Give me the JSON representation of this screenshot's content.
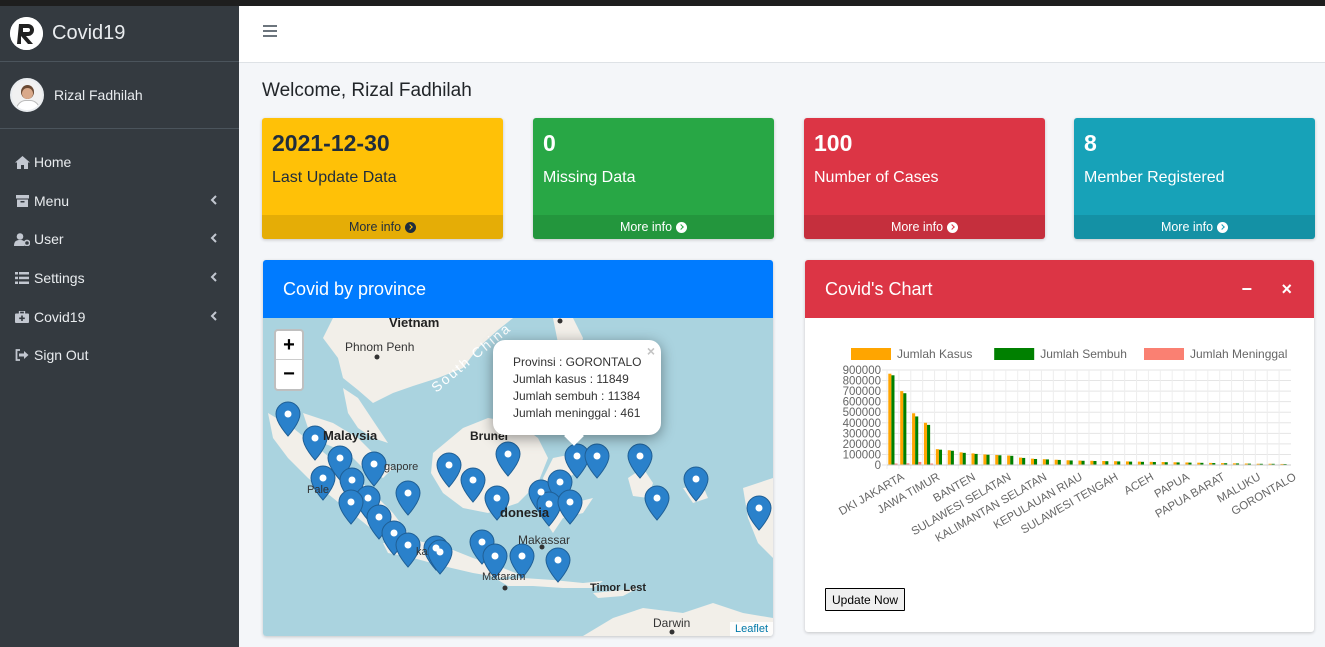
{
  "app": {
    "title": "Covid19"
  },
  "user": {
    "name": "Rizal Fadhilah"
  },
  "sidebar": {
    "items": [
      {
        "label": "Home",
        "icon": "home-icon",
        "arrow": false
      },
      {
        "label": "Menu",
        "icon": "archive-icon",
        "arrow": true
      },
      {
        "label": "User",
        "icon": "user-gear-icon",
        "arrow": true
      },
      {
        "label": "Settings",
        "icon": "list-icon",
        "arrow": true
      },
      {
        "label": "Covid19",
        "icon": "briefcase-medical-icon",
        "arrow": true
      },
      {
        "label": "Sign Out",
        "icon": "sign-out-icon",
        "arrow": false
      }
    ]
  },
  "welcome": "Welcome, Rizal Fadhilah",
  "boxes": [
    {
      "value": "2021-12-30",
      "label": "Last Update Data",
      "footer": "More info",
      "color": "#ffc107"
    },
    {
      "value": "0",
      "label": "Missing Data",
      "footer": "More info",
      "color": "#28a745"
    },
    {
      "value": "100",
      "label": "Number of Cases",
      "footer": "More info",
      "color": "#dc3545"
    },
    {
      "value": "8",
      "label": "Member Registered",
      "footer": "More info",
      "color": "#17a2b8"
    }
  ],
  "map_card": {
    "title": "Covid by province",
    "zoom_in": "+",
    "zoom_out": "−",
    "attribution": "Leaflet",
    "popup": {
      "close": "×",
      "province": "Provinsi : GORONTALO",
      "cases": "Jumlah kasus : 11849",
      "recovered": "Jumlah sembuh : 11384",
      "deaths": "Jumlah meninggal : 461"
    },
    "labels": {
      "vietnam": "Vietnam",
      "phnom_penh": "Phnom Penh",
      "malaysia": "Malaysia",
      "brunei": "Brunei",
      "singapore": "gapore",
      "indonesia": "donesia",
      "makassar": "Makassar",
      "mataram": "Mataram",
      "timor": "Timor Lest",
      "darwin": "Darwin",
      "south_china": "South China",
      "palembang": "Pale",
      "jakarta": "ka"
    }
  },
  "chart_card": {
    "title": "Covid's Chart",
    "minimize": "−",
    "close": "×",
    "update_button": "Update Now"
  },
  "chart_data": {
    "type": "bar",
    "legend_position": "top",
    "grid": true,
    "ylim": [
      0,
      900000
    ],
    "yticks": [
      0,
      100000,
      200000,
      300000,
      400000,
      500000,
      600000,
      700000,
      800000,
      900000
    ],
    "series": [
      {
        "name": "Jumlah Kasus",
        "color": "#ffa500",
        "values": [
          865000,
          700000,
          490000,
          400000,
          150000,
          140000,
          120000,
          110000,
          100000,
          95000,
          90000,
          70000,
          60000,
          55000,
          50000,
          45000,
          42000,
          40000,
          38000,
          36000,
          34000,
          32000,
          30000,
          28000,
          26000,
          24000,
          22000,
          20000,
          18000,
          16000,
          14000,
          12000,
          11849,
          10000
        ]
      },
      {
        "name": "Jumlah Sembuh",
        "color": "#008000",
        "values": [
          850000,
          680000,
          460000,
          380000,
          145000,
          135000,
          115000,
          105000,
          97000,
          92000,
          87000,
          67000,
          57000,
          53000,
          48000,
          43000,
          40000,
          38000,
          36000,
          34000,
          32000,
          30000,
          28500,
          26500,
          24500,
          22500,
          20500,
          18500,
          17000,
          15000,
          13000,
          11500,
          11384,
          9500
        ]
      },
      {
        "name": "Jumlah Meninggal",
        "color": "#fa8072",
        "values": [
          14000,
          16000,
          29000,
          14000,
          3000,
          4000,
          3500,
          3000,
          2500,
          2500,
          2000,
          2000,
          1800,
          1500,
          1300,
          1200,
          1100,
          1000,
          900,
          850,
          800,
          750,
          700,
          650,
          600,
          550,
          500,
          480,
          470,
          465,
          462,
          461,
          461,
          300
        ]
      }
    ],
    "tick_labels": [
      "DKI JAKARTA",
      "JAWA TIMUR",
      "BANTEN",
      "SULAWESI SELATAN",
      "KALIMANTAN SELATAN",
      "KEPULAUAN RIAU",
      "SULAWESI TENGAH",
      "ACEH",
      "PAPUA",
      "PAPUA BARAT",
      "MALUKU",
      "GORONTALO"
    ]
  }
}
